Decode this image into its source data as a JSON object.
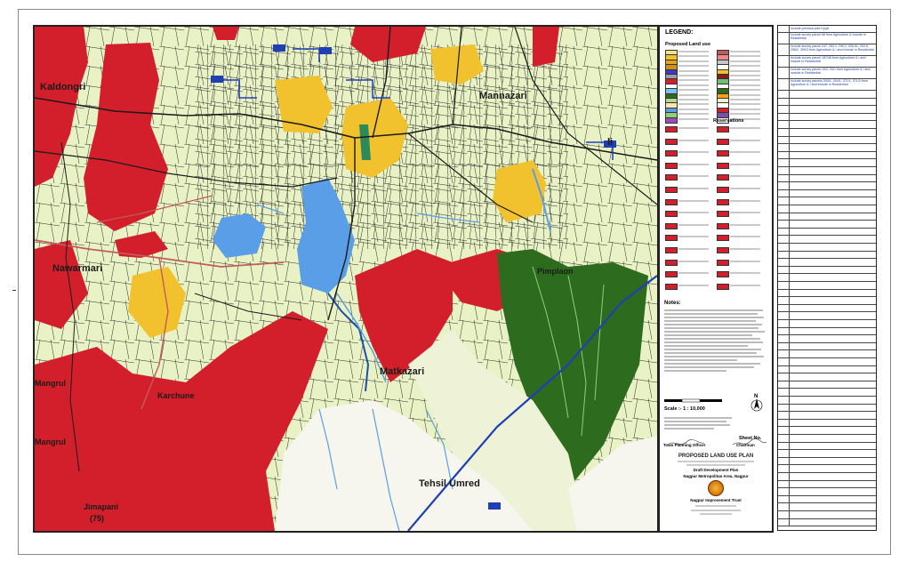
{
  "map": {
    "places": {
      "kaldongri": "Kaldongri",
      "mannazari": "Mannazari",
      "nawarmari": "Nawarmari",
      "pimplaon": "Pimplaon",
      "matkazari": "Matkazari",
      "karchune": "Karchune",
      "mangrul_1": "Mangrul",
      "mangrul_2": "Mangrul",
      "tehsil_umred": "Tehsil Umred",
      "jimapani": "Jimapani",
      "jimapani_no": "(75)",
      "li": "li"
    },
    "colors": {
      "agriculture": "#e9f2c4",
      "residential": "#f2c12e",
      "public": "#d21f2b",
      "forest": "#2d6b1e",
      "water": "#5b9ee8",
      "road": "#1b1b1b",
      "highway": "#c25b5b",
      "boundary": "#1f3fb5"
    }
  },
  "legend": {
    "title": "LEGEND:",
    "proposed": "Proposed Land use",
    "reservations": "Reservations",
    "items": [
      {
        "c": "#f2e08a"
      },
      {
        "c": "#f2c12e"
      },
      {
        "c": "#e0a420"
      },
      {
        "c": "#d68f10"
      },
      {
        "c": "#3a3ad2"
      },
      {
        "c": "#9aa0a8"
      },
      {
        "c": "#d21f2b"
      },
      {
        "c": "#ffffff"
      },
      {
        "c": "#7ec0f0"
      },
      {
        "c": "#2d6b1e"
      },
      {
        "c": "#b7d68a"
      },
      {
        "c": "#f5e7b0"
      },
      {
        "c": "#5b9ee8"
      },
      {
        "c": "#8fd07a"
      },
      {
        "c": "#9b4db0"
      },
      {
        "c": "#c25b5b"
      },
      {
        "c": "#e98a8a"
      },
      {
        "c": "#c7c7c7"
      },
      {
        "c": "#ffffff"
      },
      {
        "c": "#f2c12e"
      },
      {
        "c": "#8b1a1a"
      },
      {
        "c": "#6fbf73"
      },
      {
        "c": "#ffffff"
      },
      {
        "c": "#2d6b1e"
      },
      {
        "c": "#ff9f1a"
      },
      {
        "c": "#e9f2c4"
      },
      {
        "c": "#ffffff"
      },
      {
        "c": "#d21f2b"
      },
      {
        "c": "#7d4fa8"
      },
      {
        "c": "#ffffff"
      }
    ],
    "res_items": [
      {
        "c": "#d21f2b"
      },
      {
        "c": "#d21f2b"
      },
      {
        "c": "#d21f2b"
      },
      {
        "c": "#d21f2b"
      },
      {
        "c": "#d21f2b"
      },
      {
        "c": "#d21f2b"
      },
      {
        "c": "#d21f2b"
      },
      {
        "c": "#d21f2b"
      },
      {
        "c": "#d21f2b"
      },
      {
        "c": "#d21f2b"
      },
      {
        "c": "#d21f2b"
      },
      {
        "c": "#d21f2b"
      },
      {
        "c": "#d21f2b"
      },
      {
        "c": "#d21f2b"
      },
      {
        "c": "#d21f2b"
      },
      {
        "c": "#d21f2b"
      },
      {
        "c": "#d21f2b"
      },
      {
        "c": "#d21f2b"
      },
      {
        "c": "#d21f2b"
      },
      {
        "c": "#d21f2b"
      },
      {
        "c": "#d21f2b"
      },
      {
        "c": "#d21f2b"
      },
      {
        "c": "#d21f2b"
      },
      {
        "c": "#d21f2b"
      },
      {
        "c": "#d21f2b"
      },
      {
        "c": "#d21f2b"
      },
      {
        "c": "#d21f2b"
      },
      {
        "c": "#d21f2b"
      }
    ]
  },
  "notes_title": "Notes:",
  "scale": "Scale :- 1 : 10,000",
  "sheet_no": "Sheet No.",
  "north": "N",
  "town_planning_officer": "Town Planning Officer",
  "chairman": "Chairman",
  "plan_title": "PROPOSED LAND USE PLAN",
  "plan_line2": "Draft Development Plan",
  "plan_line3": "Nagpur Metropolitan Area, Nagpur",
  "trust": "Nagpur Improvement Trust",
  "modifications": [
    {
      "text": "Include previous part Kp(at"
    },
    {
      "text": "Include survey parcel 68 from Agriculture & Include in Residential"
    },
    {
      "text": "Include survey parcel 247, 253.1, 290.2, 326.01, 294.5, 298/2, 399/3 from Agriculture & I and include in Residential"
    },
    {
      "text": "Include survey parcel 187/48 from Agriculture & I and include in Residential"
    },
    {
      "text": "Include survey parcel 19/2, 20/1 from Agriculture & I and include in Residential"
    },
    {
      "text": "Include survey parcels 300/1, 304/1, 371/1, 371/3 from Agriculture & I and include in Residential"
    }
  ]
}
